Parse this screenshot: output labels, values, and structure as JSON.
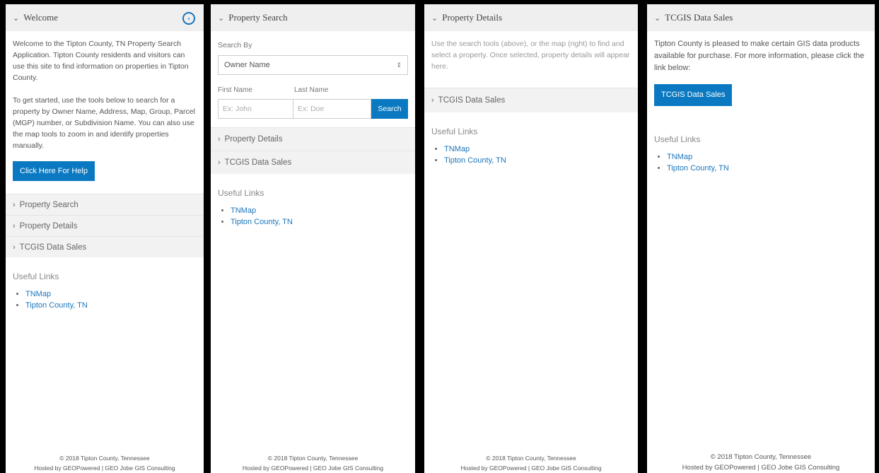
{
  "footer": {
    "copyright": "© 2018 Tipton County, Tennessee",
    "hosted": "Hosted by GEOPowered | GEO Jobe GIS Consulting"
  },
  "useful_links": {
    "heading": "Useful Links",
    "items": [
      "TNMap",
      "Tipton County, TN"
    ]
  },
  "panel1": {
    "title": "Welcome",
    "collapse_icon": "chevron-left-circle-icon",
    "intro": "Welcome to the Tipton County, TN Property Search Application. Tipton County residents and visitors can use this site to find information on properties in Tipton County.",
    "instructions": "To get started, use the tools below to search for a property by Owner Name, Address, Map, Group, Parcel (MGP) number, or Subdivision Name. You can also use the map tools to zoom in and identify properties manually.",
    "help_button": "Click Here For Help",
    "sections": [
      "Property Search",
      "Property Details",
      "TCGIS Data Sales"
    ]
  },
  "panel2": {
    "title": "Property Search",
    "search_by_label": "Search By",
    "search_by_value": "Owner Name",
    "first_name_label": "First Name",
    "last_name_label": "Last Name",
    "first_name_placeholder": "Ex: John",
    "last_name_placeholder": "Ex: Doe",
    "search_button": "Search",
    "sections": [
      "Property Details",
      "TCGIS Data Sales"
    ]
  },
  "panel3": {
    "title": "Property Details",
    "message": "Use the search tools (above), or the map (right) to find and select a property. Once selected, property details will appear here.",
    "sections": [
      "TCGIS Data Sales"
    ]
  },
  "panel4": {
    "title": "TCGIS Data Sales",
    "message": "Tipton County is pleased to make certain GIS data products available for purchase. For more information, please click the link below:",
    "button": "TCGIS Data Sales"
  }
}
